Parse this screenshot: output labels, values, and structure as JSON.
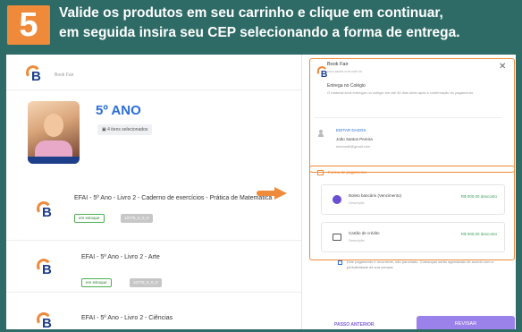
{
  "banner": {
    "step": "5",
    "line1": "Valide os produtos em seu carrinho e clique em continuar,",
    "line2": "em seguida insira seu CEP selecionando a forma de entrega."
  },
  "app": {
    "brand": "Book Fair",
    "product": {
      "grade": "5º ANO",
      "selected": "4 itens selecionados"
    },
    "items": [
      {
        "title": "EFAI - 5º Ano - Livro 2 - Caderno de exercícios - Prática de Matemática",
        "stock": "em estoque",
        "code": "10775_0_0_0"
      },
      {
        "title": "EFAI - 5º Ano - Livro 2 - Arte",
        "stock": "em estoque",
        "code": "10775_0_0_0"
      },
      {
        "title": "EFAI - 5º Ano - Livro 2 - Ciências",
        "stock": "",
        "code": ""
      }
    ]
  },
  "panel": {
    "brand": "Book Fair",
    "brand_sub": "com.asset.sofr.com.br",
    "shipping_title": "Entrega no Colégio",
    "shipping_text": "O material será entregue no colégio em até 30 dias úteis após a confirmação do pagamento.",
    "edit_label": "EDITAR DADOS",
    "customer_name": "João Santos Pereira",
    "customer_email": "seuemail@gmail.com",
    "payment_title": "Forma de pagamento",
    "options": [
      {
        "name": "Boleto bancário (Vencimento)",
        "desc": "Descrição",
        "price": "R$ 000,00 desconto"
      },
      {
        "name": "Cartão de crédito",
        "desc": "Descrição",
        "price": "R$ 000,00 desconto"
      }
    ],
    "checkbox_text": "Este pagamento é recorrente, não parcelado. Cobranças serão agendadas de acordo com a periodicidade da sua compra.",
    "back_label": "PASSO ANTERIOR",
    "next_label": "REVISAR"
  },
  "colors": {
    "accent": "#ef8a3a",
    "brand_blue": "#1d3f8a",
    "teal": "#2f6b66",
    "primary_btn": "#9b82ea"
  }
}
